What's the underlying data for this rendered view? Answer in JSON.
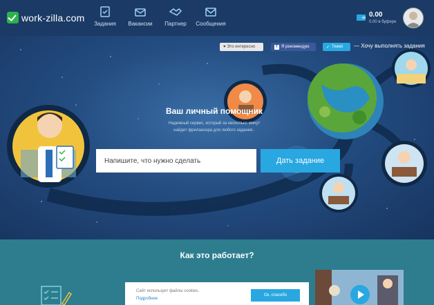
{
  "header": {
    "logo_text": "work-zilla.com",
    "nav": [
      {
        "label": "Задания",
        "icon": "tasks-icon"
      },
      {
        "label": "Вакансии",
        "icon": "vacancies-icon"
      },
      {
        "label": "Партнер",
        "icon": "partner-icon"
      },
      {
        "label": "Сообщения",
        "icon": "messages-icon"
      }
    ],
    "balance": "0.00",
    "buffer": "0.00 в буфере"
  },
  "hero": {
    "share_interesting": "♥ Это интересно",
    "share_recommend": "Я рекомендую",
    "share_tweet": "Tweet",
    "want_to_do": "— Хочу выполнять задания",
    "title": "Ваш личный помощник",
    "subtitle_line1": "Надежный сервис, который за несколько минут",
    "subtitle_line2": "найдет фрилансера для любого задания..",
    "input_placeholder": "Напишите, что нужно сделать",
    "button": "Дать задание"
  },
  "how": {
    "title": "Как это работает?"
  },
  "cookie": {
    "text": "Сайт использует файлы cookies.",
    "more": "Подробнее",
    "button": "Ок, спасибо"
  },
  "colors": {
    "header_bg": "#1b3b66",
    "accent": "#29a7e0",
    "logo_green": "#2bb24c",
    "how_bg": "#2d7d8f"
  }
}
